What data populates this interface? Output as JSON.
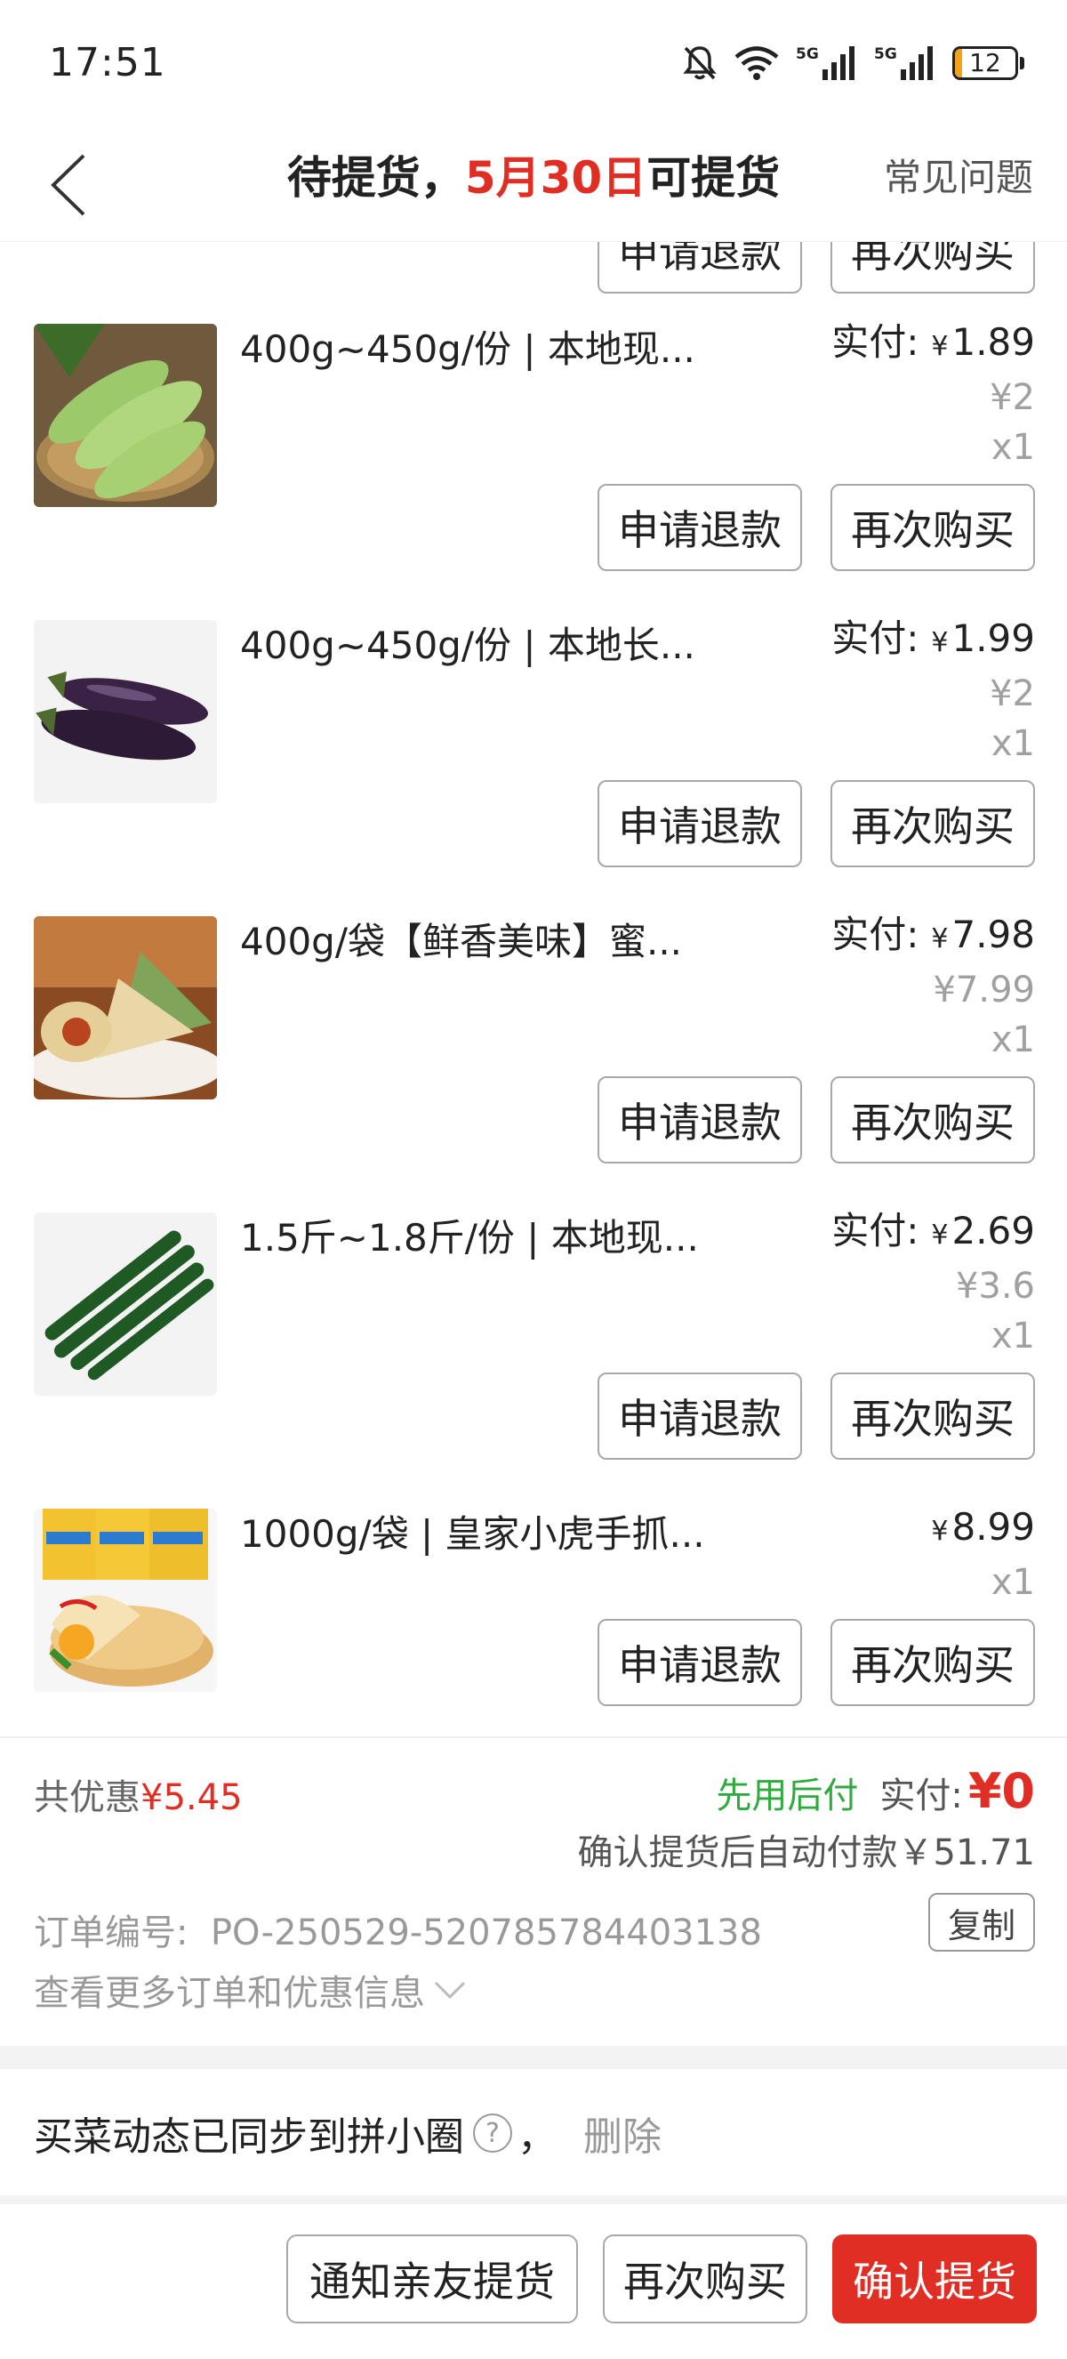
{
  "status_bar": {
    "time": "17:51",
    "network_label": "5G",
    "network_label_2": "5G",
    "battery_level": "12",
    "battery_fraction": 0.12
  },
  "nav": {
    "title_prefix": "待提货，",
    "title_highlight": "5月30日",
    "title_suffix": "可提货",
    "faq_label": "常见问题"
  },
  "partial_buttons": {
    "refund": "申请退款",
    "rebuy": "再次购买"
  },
  "items": [
    {
      "name": "400g~450g/份 | 本地现...",
      "paid_label": "实付:",
      "currency": "¥",
      "paid": "1.89",
      "original": "¥2",
      "quantity": "x1",
      "refund_label": "申请退款",
      "rebuy_label": "再次购买",
      "thumb": "zucchini"
    },
    {
      "name": "400g~450g/份 | 本地长...",
      "paid_label": "实付:",
      "currency": "¥",
      "paid": "1.99",
      "original": "¥2",
      "quantity": "x1",
      "refund_label": "申请退款",
      "rebuy_label": "再次购买",
      "thumb": "eggplant"
    },
    {
      "name": "400g/袋【鲜香美味】蜜...",
      "paid_label": "实付:",
      "currency": "¥",
      "paid": "7.98",
      "original": "¥7.99",
      "quantity": "x1",
      "refund_label": "申请退款",
      "rebuy_label": "再次购买",
      "thumb": "zongzi"
    },
    {
      "name": "1.5斤~1.8斤/份 | 本地现...",
      "paid_label": "实付:",
      "currency": "¥",
      "paid": "2.69",
      "original": "¥3.6",
      "quantity": "x1",
      "refund_label": "申请退款",
      "rebuy_label": "再次购买",
      "thumb": "cucumber"
    },
    {
      "name": "1000g/袋 | 皇家小虎手抓...",
      "paid_label": "",
      "currency": "¥",
      "paid": "8.99",
      "original": "",
      "quantity": "x1",
      "refund_label": "申请退款",
      "rebuy_label": "再次购买",
      "thumb": "pancake"
    }
  ],
  "summary": {
    "discount_label": "共优惠",
    "discount_amount": "¥5.45",
    "pay_later": "先用后付",
    "paid_label": "实付:",
    "paid_amount": "¥0",
    "auto_pay": "确认提货后自动付款￥51.71",
    "order_label": "订单编号:",
    "order_number": "PO-250529-520785784403138",
    "copy_label": "复制",
    "more_info": "查看更多订单和优惠信息"
  },
  "sync": {
    "text": "买菜动态已同步到拼小圈",
    "comma": "，",
    "delete_label": "删除"
  },
  "bottom_bar": {
    "notify_label": "通知亲友提货",
    "rebuy_label": "再次购买",
    "confirm_label": "确认提货"
  },
  "colors": {
    "accent_red": "#e02e24",
    "pay_later_green": "#2eaa3e",
    "battery": "#f2a21b"
  },
  "icons": [
    "back-arrow-icon",
    "mute-icon",
    "wifi-icon",
    "signal-icon",
    "battery-icon",
    "chevron-down-icon",
    "help-icon"
  ]
}
